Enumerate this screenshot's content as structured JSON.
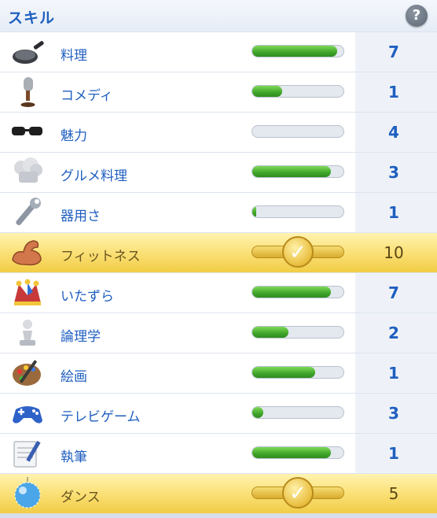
{
  "header": {
    "title": "スキル",
    "help_label": "?"
  },
  "skills": [
    {
      "label": "料理",
      "level": "7",
      "progress": 0.93,
      "maxed": false,
      "icon": "frying-pan-icon"
    },
    {
      "label": "コメディ",
      "level": "1",
      "progress": 0.33,
      "maxed": false,
      "icon": "microphone-icon"
    },
    {
      "label": "魅力",
      "level": "4",
      "progress": 0.0,
      "maxed": false,
      "icon": "sunglasses-icon"
    },
    {
      "label": "グルメ料理",
      "level": "3",
      "progress": 0.86,
      "maxed": false,
      "icon": "chef-hat-icon"
    },
    {
      "label": "器用さ",
      "level": "1",
      "progress": 0.04,
      "maxed": false,
      "icon": "wrench-icon"
    },
    {
      "label": "フィットネス",
      "level": "10",
      "progress": 1.0,
      "maxed": true,
      "icon": "flexed-arm-icon"
    },
    {
      "label": "いたずら",
      "level": "7",
      "progress": 0.86,
      "maxed": false,
      "icon": "jester-hat-icon"
    },
    {
      "label": "論理学",
      "level": "2",
      "progress": 0.4,
      "maxed": false,
      "icon": "chess-pawn-icon"
    },
    {
      "label": "絵画",
      "level": "1",
      "progress": 0.69,
      "maxed": false,
      "icon": "paint-palette-icon"
    },
    {
      "label": "テレビゲーム",
      "level": "3",
      "progress": 0.12,
      "maxed": false,
      "icon": "game-controller-icon"
    },
    {
      "label": "執筆",
      "level": "1",
      "progress": 0.86,
      "maxed": false,
      "icon": "notepad-pen-icon"
    },
    {
      "label": "ダンス",
      "level": "5",
      "progress": 1.0,
      "maxed": true,
      "icon": "disco-ball-icon"
    }
  ],
  "colors": {
    "accent": "#1f5fc0",
    "progress_green": "#3fa52a",
    "highlight_gold": "#f1cc45"
  }
}
